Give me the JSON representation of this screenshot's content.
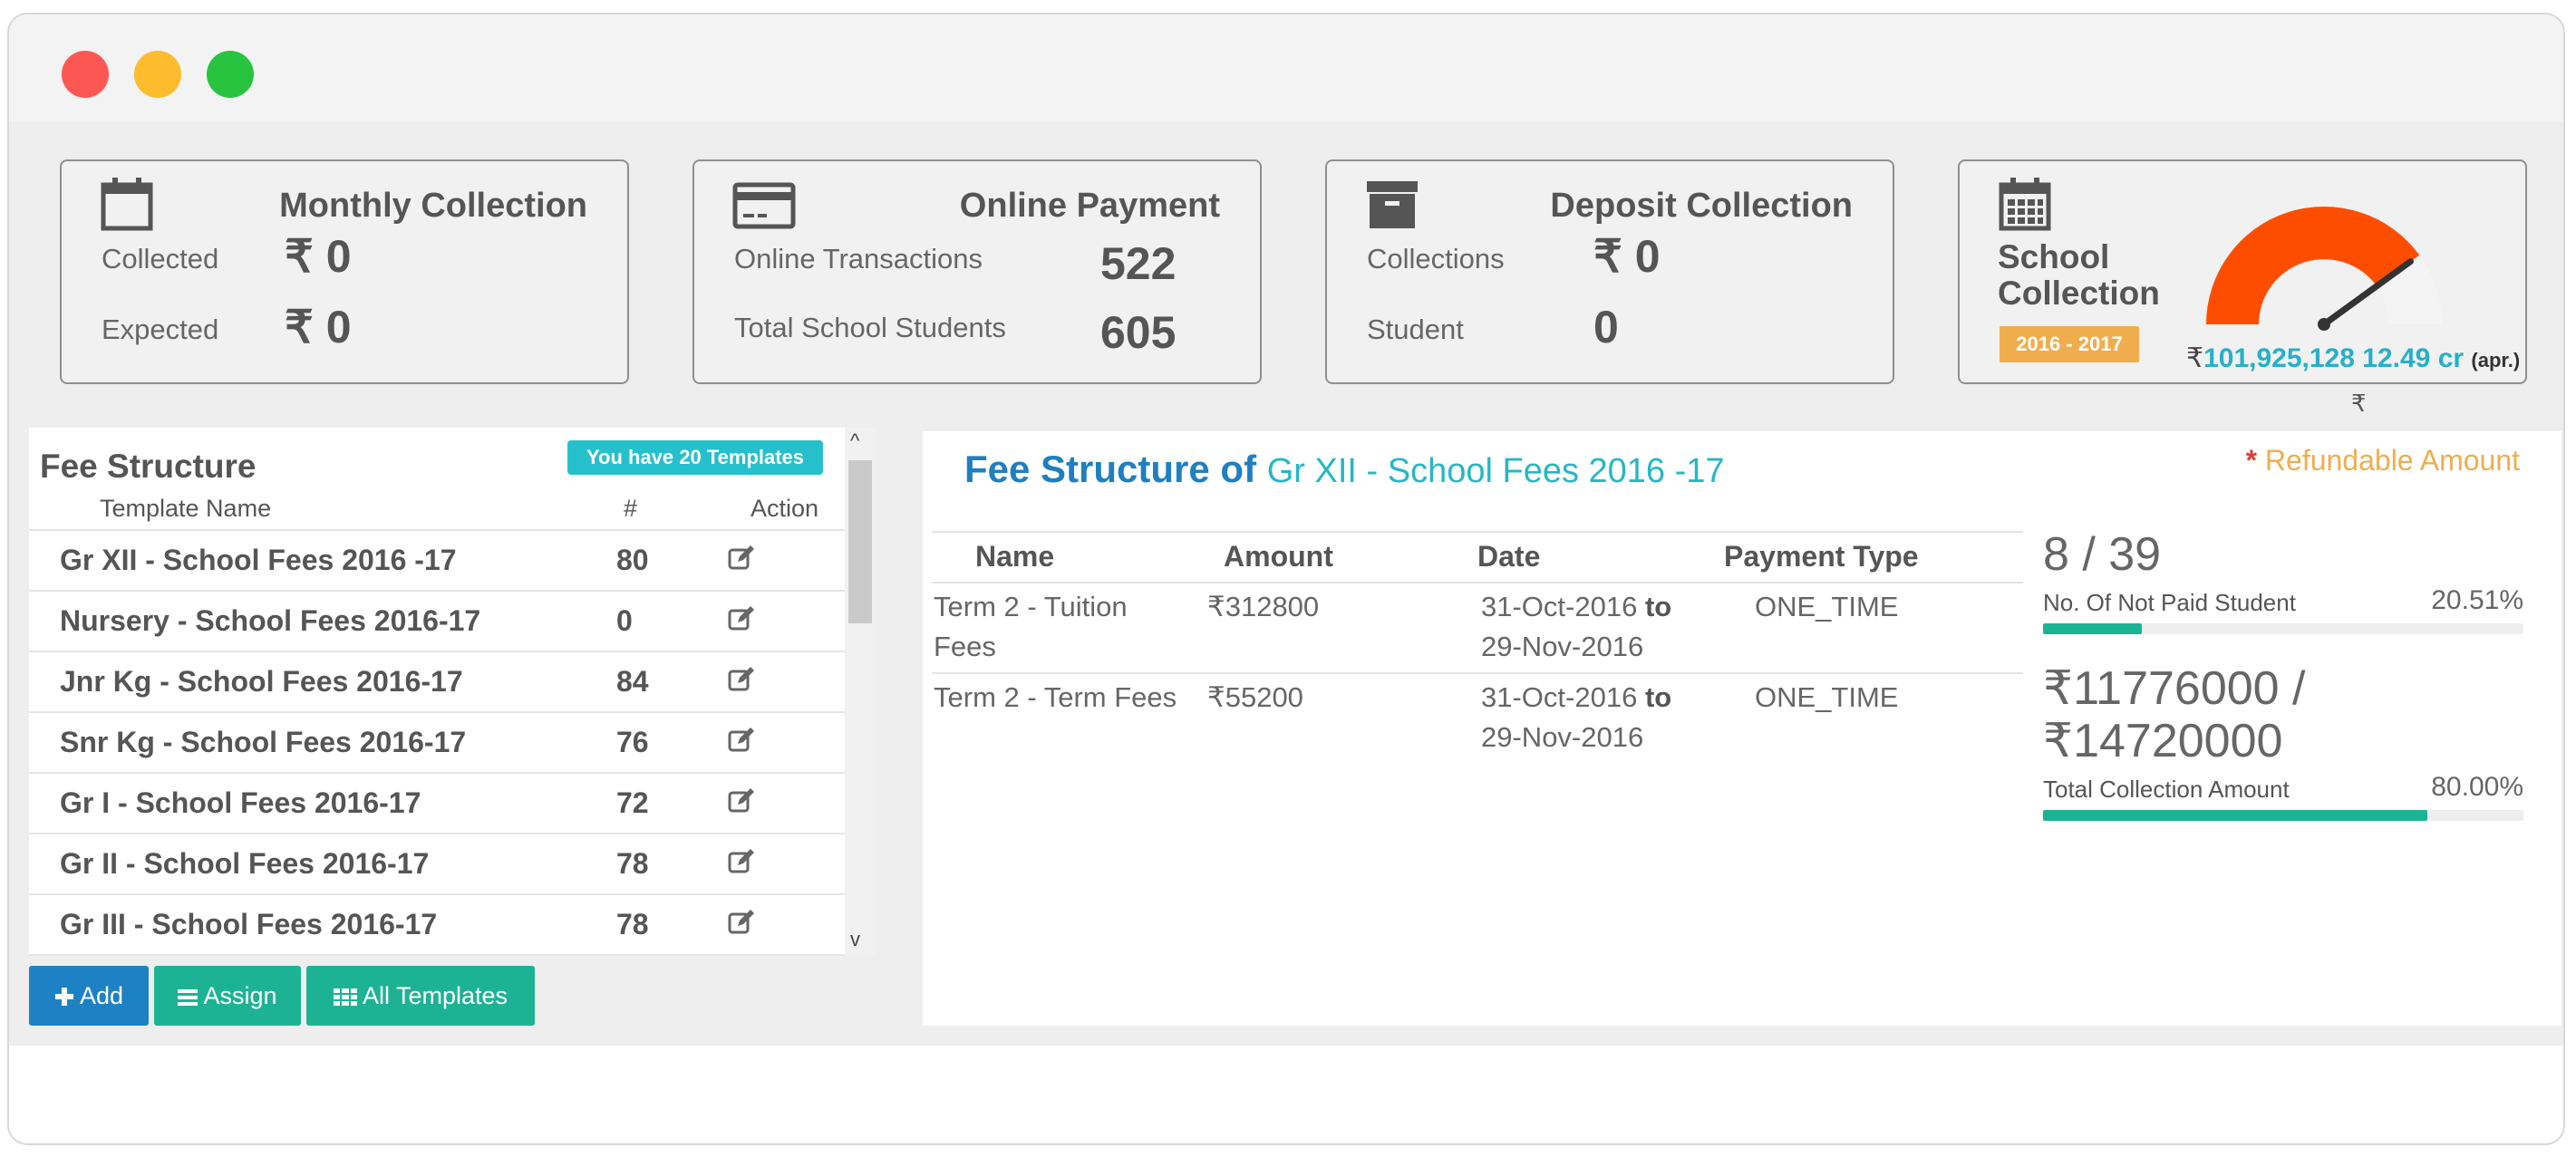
{
  "cards": {
    "monthly": {
      "title": "Monthly Collection",
      "collected_label": "Collected",
      "collected_value": "₹ 0",
      "expected_label": "Expected",
      "expected_value": "₹ 0"
    },
    "online": {
      "title": "Online Payment",
      "transactions_label": "Online Transactions",
      "transactions_value": "522",
      "students_label": "Total School Students",
      "students_value": "605"
    },
    "deposit": {
      "title": "Deposit Collection",
      "collections_label": "Collections",
      "collections_value": "₹ 0",
      "student_label": "Student",
      "student_value": "0"
    },
    "school": {
      "title": "School Collection",
      "year_badge": "2016 - 2017",
      "currency": "₹",
      "amount": "101,925,128",
      "crore": "12.49 cr",
      "apr": "(apr.)",
      "below_symbol": "₹",
      "gauge_level": 0.8
    }
  },
  "fee_structure": {
    "title": "Fee Structure",
    "templates_badge": "You have 20 Templates",
    "col_name": "Template Name",
    "col_count": "#",
    "col_action": "Action",
    "rows": [
      {
        "name": "Gr XII - School Fees 2016 -17",
        "count": "80"
      },
      {
        "name": "Nursery - School Fees 2016-17",
        "count": "0"
      },
      {
        "name": "Jnr Kg - School Fees 2016-17",
        "count": "84"
      },
      {
        "name": "Snr Kg - School Fees 2016-17",
        "count": "76"
      },
      {
        "name": "Gr I - School Fees 2016-17",
        "count": "72"
      },
      {
        "name": "Gr II - School Fees 2016-17",
        "count": "78"
      },
      {
        "name": "Gr III - School Fees 2016-17",
        "count": "78"
      }
    ],
    "buttons": {
      "add": "Add",
      "assign": "Assign",
      "all_templates": "All Templates"
    }
  },
  "detail": {
    "title_prefix": "Fee Structure of",
    "title_name": "Gr XII - School Fees 2016 -17",
    "refundable_star": "*",
    "refundable_label": "Refundable Amount",
    "columns": [
      "Name",
      "Amount",
      "Date",
      "Payment Type"
    ],
    "rows": [
      {
        "name": "Term 2 - Tuition Fees",
        "amount": "₹312800",
        "date_from": "31-Oct-2016",
        "to": "to",
        "date_to": "29-Nov-2016",
        "type": "ONE_TIME"
      },
      {
        "name": "Term 2 - Term Fees",
        "amount": "₹55200",
        "date_from": "31-Oct-2016",
        "to": "to",
        "date_to": "29-Nov-2016",
        "type": "ONE_TIME"
      }
    ],
    "not_paid": {
      "ratio": "8 / 39",
      "label": "No. Of Not Paid Student",
      "percent": "20.51%",
      "level": 0.2051
    },
    "collection": {
      "amount_line1": "₹11776000 /",
      "amount_line2": "₹14720000",
      "label": "Total Collection Amount",
      "percent": "80.00%",
      "level": 0.8
    },
    "colors": {
      "accent_blue": "#1f7fc0",
      "accent_teal": "#26b7c6",
      "success": "#1cb394",
      "warning": "#f0ad4e",
      "gauge": "#ff4d00"
    }
  }
}
